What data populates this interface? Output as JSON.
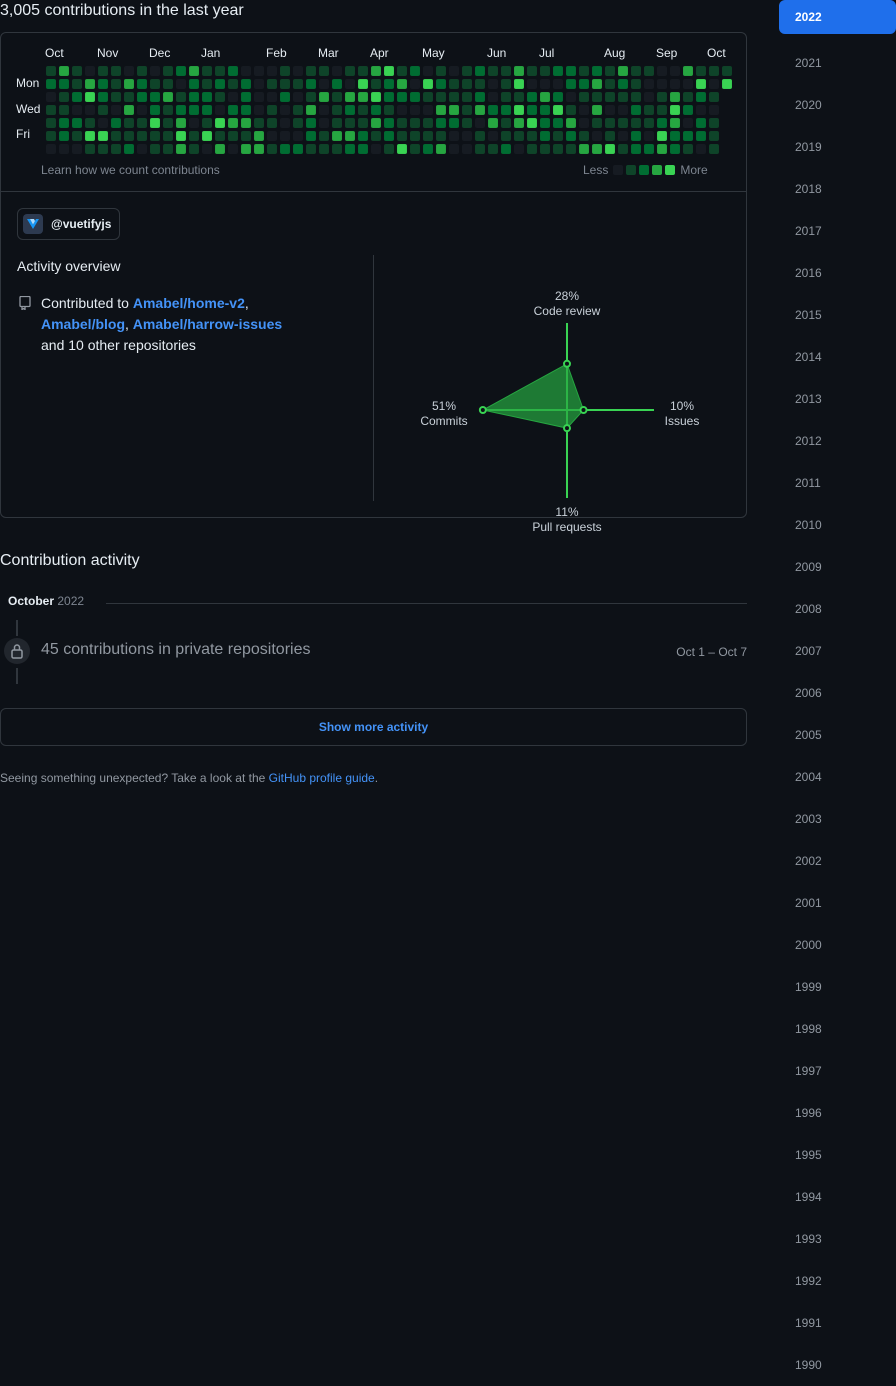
{
  "header": {
    "title": "3,005 contributions in the last year"
  },
  "calendar": {
    "months": [
      "Oct",
      "Nov",
      "Dec",
      "Jan",
      "Feb",
      "Mar",
      "Apr",
      "May",
      "Jun",
      "Jul",
      "Aug",
      "Sep",
      "Oct"
    ],
    "days": [
      "Mon",
      "Wed",
      "Fri"
    ],
    "learn_link": "Learn how we count contributions",
    "legend_less": "Less",
    "legend_more": "More",
    "colors": [
      "#161b22",
      "#0e4429",
      "#006d32",
      "#26a641",
      "#39d353"
    ]
  },
  "org": {
    "handle": "@vuetifyjs"
  },
  "overview": {
    "title": "Activity overview",
    "prefix": "Contributed to ",
    "repo1": "Amabel/home-v2",
    "repo2": "Amabel/blog",
    "repo3": "Amabel/harrow-issues",
    "suffix": "and 10 other repositories"
  },
  "radar": {
    "code_review_pct": "28%",
    "code_review_label": "Code review",
    "commits_pct": "51%",
    "commits_label": "Commits",
    "issues_pct": "10%",
    "issues_label": "Issues",
    "pr_pct": "11%",
    "pr_label": "Pull requests",
    "values": {
      "code_review": 28,
      "commits": 51,
      "issues": 10,
      "pull_requests": 11
    }
  },
  "activity": {
    "title": "Contribution activity",
    "month": "October",
    "year": " 2022",
    "private_text": "45 contributions in private repositories",
    "date_range": "Oct 1 – Oct 7",
    "show_more": "Show more activity",
    "footnote_prefix": "Seeing something unexpected? Take a look at the ",
    "footnote_link": "GitHub profile guide",
    "footnote_suffix": "."
  },
  "years": [
    "2022",
    "2021",
    "2020",
    "2019",
    "2018",
    "2017",
    "2016",
    "2015",
    "2014",
    "2013",
    "2012",
    "2011",
    "2010",
    "2009",
    "2008",
    "2007",
    "2006",
    "2005",
    "2004",
    "2003",
    "2002",
    "2001",
    "2000",
    "1999",
    "1998",
    "1997",
    "1996",
    "1995",
    "1994",
    "1993",
    "1992",
    "1991",
    "1990"
  ]
}
